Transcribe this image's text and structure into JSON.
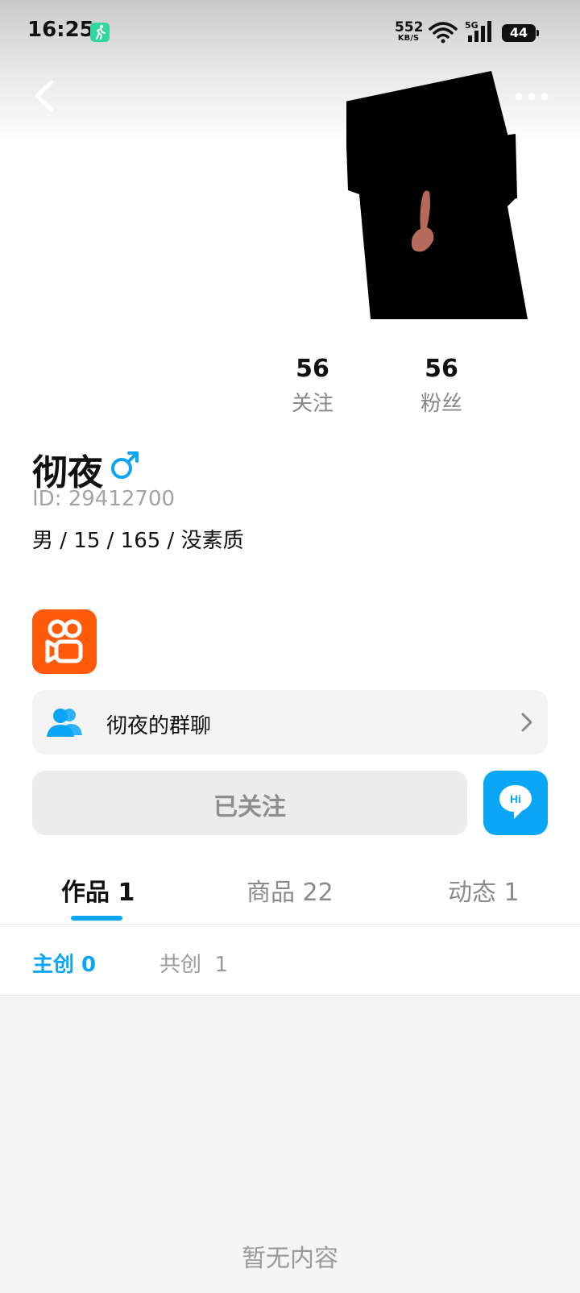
{
  "status_bar": {
    "time": "16:25",
    "net_speed": "552",
    "net_unit": "KB/S",
    "network_type": "5G",
    "battery": "44",
    "icons": [
      "fitness-app-icon",
      "wifi-icon",
      "signal-icon",
      "battery-icon"
    ]
  },
  "header": {
    "back_icon": "back-icon",
    "more_icon": "more-icon"
  },
  "profile": {
    "name": "彻夜",
    "gender": "♂",
    "gender_color": "#0aa5f5",
    "id": "ID: 29412700",
    "bio": "男 / 15 / 165 / 没素质"
  },
  "stats": [
    {
      "value": "56",
      "label": "关注"
    },
    {
      "value": "56",
      "label": "粉丝"
    }
  ],
  "group_chat": {
    "label": "彻夜的群聊",
    "icon": "group-icon"
  },
  "actions": {
    "followed_label": "已关注",
    "hi_label": "Hi"
  },
  "tabs": [
    {
      "label": "作品 1",
      "active": true
    },
    {
      "label": "商品 22",
      "active": false
    },
    {
      "label": "动态 1",
      "active": false
    }
  ],
  "subtabs": [
    {
      "label": "主创 0",
      "active": true
    },
    {
      "label": "共创  1",
      "active": false
    }
  ],
  "empty_state": "暂无内容",
  "colors": {
    "accent": "#0aa5f5",
    "brand": "#ff5a0a"
  }
}
